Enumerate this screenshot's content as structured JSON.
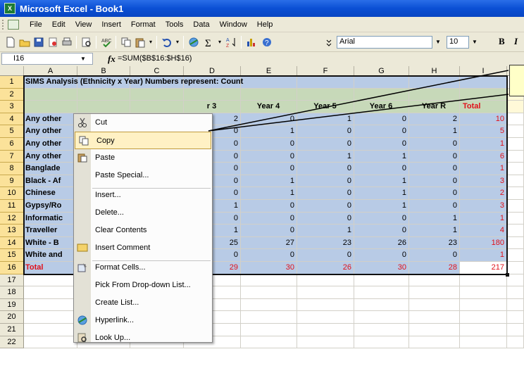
{
  "window": {
    "title": "Microsoft Excel - Book1"
  },
  "menu": [
    "File",
    "Edit",
    "View",
    "Insert",
    "Format",
    "Tools",
    "Data",
    "Window",
    "Help"
  ],
  "toolbar": {
    "icons": [
      "new-icon",
      "open-icon",
      "save-icon",
      "permission-icon",
      "print-icon",
      "print-preview-icon",
      "spelling-icon",
      "cut-icon",
      "paste-icon",
      "undo-icon",
      "hyperlink-icon",
      "autosum-icon",
      "sort-icon",
      "chart-icon",
      "help-icon"
    ],
    "font_name": "Arial",
    "font_size": "10",
    "bold_label": "B",
    "italic_label": "I"
  },
  "formula_bar": {
    "name_box": "I16",
    "fx_label": "fx",
    "formula": "=SUM($B$16:$H$16)"
  },
  "columns": [
    "A",
    "B",
    "C",
    "D",
    "E",
    "F",
    "G",
    "H",
    "I"
  ],
  "rows": [
    "1",
    "2",
    "3",
    "4",
    "5",
    "6",
    "7",
    "8",
    "9",
    "10",
    "11",
    "12",
    "13",
    "14",
    "15",
    "16",
    "17",
    "18",
    "19",
    "20",
    "21",
    "22"
  ],
  "sheet": {
    "title_cell": "SIMS Analysis (Ethnicity x Year)  Numbers represent: Count",
    "header_row": [
      "r 3",
      "Year 4",
      "Year 5",
      "Year 6",
      "Year R",
      "Total"
    ],
    "row_labels": [
      "Any other",
      "Any other",
      "Any other",
      "Any other",
      "Banglade",
      "Black - Af",
      "Chinese",
      "Gypsy/Ro",
      "Informatic",
      "Traveller",
      "White - B",
      "White and",
      "Total"
    ],
    "data": [
      [
        "2",
        "0",
        "1",
        "0",
        "2",
        "10"
      ],
      [
        "0",
        "1",
        "0",
        "0",
        "1",
        "5"
      ],
      [
        "0",
        "0",
        "0",
        "0",
        "0",
        "1"
      ],
      [
        "0",
        "0",
        "1",
        "1",
        "0",
        "6"
      ],
      [
        "0",
        "0",
        "0",
        "0",
        "0",
        "1"
      ],
      [
        "0",
        "1",
        "0",
        "1",
        "0",
        "3"
      ],
      [
        "0",
        "1",
        "0",
        "1",
        "0",
        "2"
      ],
      [
        "1",
        "0",
        "0",
        "1",
        "0",
        "3"
      ],
      [
        "0",
        "0",
        "0",
        "0",
        "1",
        "1"
      ],
      [
        "1",
        "0",
        "1",
        "0",
        "1",
        "4"
      ],
      [
        "25",
        "27",
        "23",
        "26",
        "23",
        "180"
      ],
      [
        "0",
        "0",
        "0",
        "0",
        "0",
        "1"
      ],
      [
        "29",
        "30",
        "26",
        "30",
        "28",
        "217"
      ]
    ]
  },
  "context_menu": [
    {
      "label": "Cut",
      "icon": "cut-icon"
    },
    {
      "label": "Copy",
      "icon": "copy-icon",
      "highlighted": true
    },
    {
      "label": "Paste",
      "icon": "paste-icon"
    },
    {
      "label": "Paste Special...",
      "icon": ""
    },
    {
      "label": "Insert...",
      "icon": ""
    },
    {
      "label": "Delete...",
      "icon": ""
    },
    {
      "label": "Clear Contents",
      "icon": ""
    },
    {
      "label": "Insert Comment",
      "icon": "comment-icon"
    },
    {
      "label": "Format Cells...",
      "icon": "format-cells-icon"
    },
    {
      "label": "Pick From Drop-down List...",
      "icon": ""
    },
    {
      "label": "Create List...",
      "icon": ""
    },
    {
      "label": "Hyperlink...",
      "icon": "hyperlink-icon"
    },
    {
      "label": "Look Up...",
      "icon": "research-icon"
    }
  ],
  "colors": {
    "selection": "#b8cbe6",
    "title_bar": "#0a4fd4",
    "total_text": "#e0101a",
    "header_band": "#d8e6c8",
    "menu_highlight": "#fff1c4"
  }
}
